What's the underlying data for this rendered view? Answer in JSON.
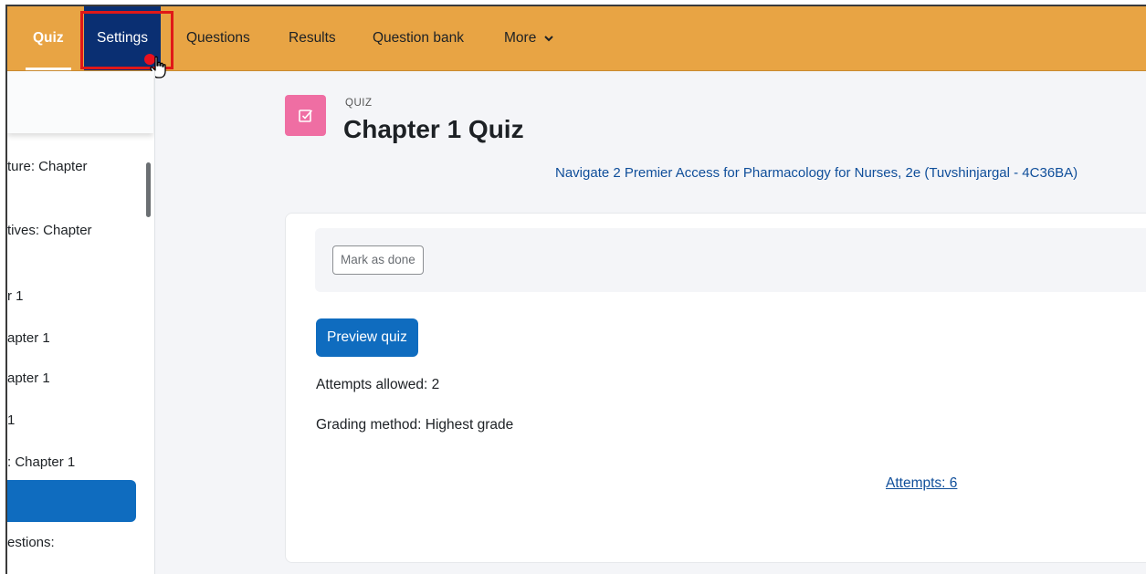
{
  "nav": {
    "tabs": [
      {
        "label": "Quiz"
      },
      {
        "label": "Settings"
      },
      {
        "label": "Questions"
      },
      {
        "label": "Results"
      },
      {
        "label": "Question bank"
      },
      {
        "label": "More"
      }
    ]
  },
  "sidebar": {
    "items": [
      {
        "label": "ture: Chapter"
      },
      {
        "label": "tives: Chapter"
      },
      {
        "label": "r 1"
      },
      {
        "label": "apter 1"
      },
      {
        "label": "apter 1"
      },
      {
        "label": "1"
      },
      {
        "label": ": Chapter 1"
      },
      {
        "label": "estions:"
      }
    ]
  },
  "header": {
    "kicker": "QUIZ",
    "title": "Chapter 1 Quiz",
    "course_link": "Navigate 2 Premier Access for Pharmacology for Nurses, 2e (Tuvshinjargal - 4C36BA)"
  },
  "main": {
    "mark_done_label": "Mark as done",
    "preview_label": "Preview quiz",
    "attempts_allowed": "Attempts allowed: 2",
    "grading_method": "Grading method: Highest grade",
    "attempts_link": "Attempts: 6"
  },
  "colors": {
    "nav_bg": "#e8a444",
    "accent": "#0f6cbf",
    "quiz_icon_bg": "#ef6ea3",
    "highlight": "#e01818"
  }
}
